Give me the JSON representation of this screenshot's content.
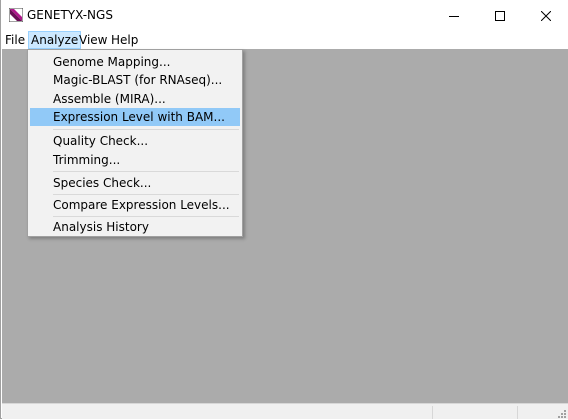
{
  "window": {
    "title": "GENETYX-NGS"
  },
  "menubar": {
    "items": [
      "File",
      "Analyze",
      "View",
      "Help"
    ]
  },
  "analyze_menu": {
    "items": [
      "Genome Mapping...",
      "Magic-BLAST (for RNAseq)...",
      "Assemble (MIRA)...",
      "Expression Level with BAM...",
      "Quality Check...",
      "Trimming...",
      "Species Check...",
      "Compare Expression Levels...",
      "Analysis History"
    ],
    "highlighted": "Expression Level with BAM..."
  },
  "colors": {
    "highlight": "#91c9f7",
    "client_background": "#ababab",
    "menu_selected": "#cce8ff"
  }
}
